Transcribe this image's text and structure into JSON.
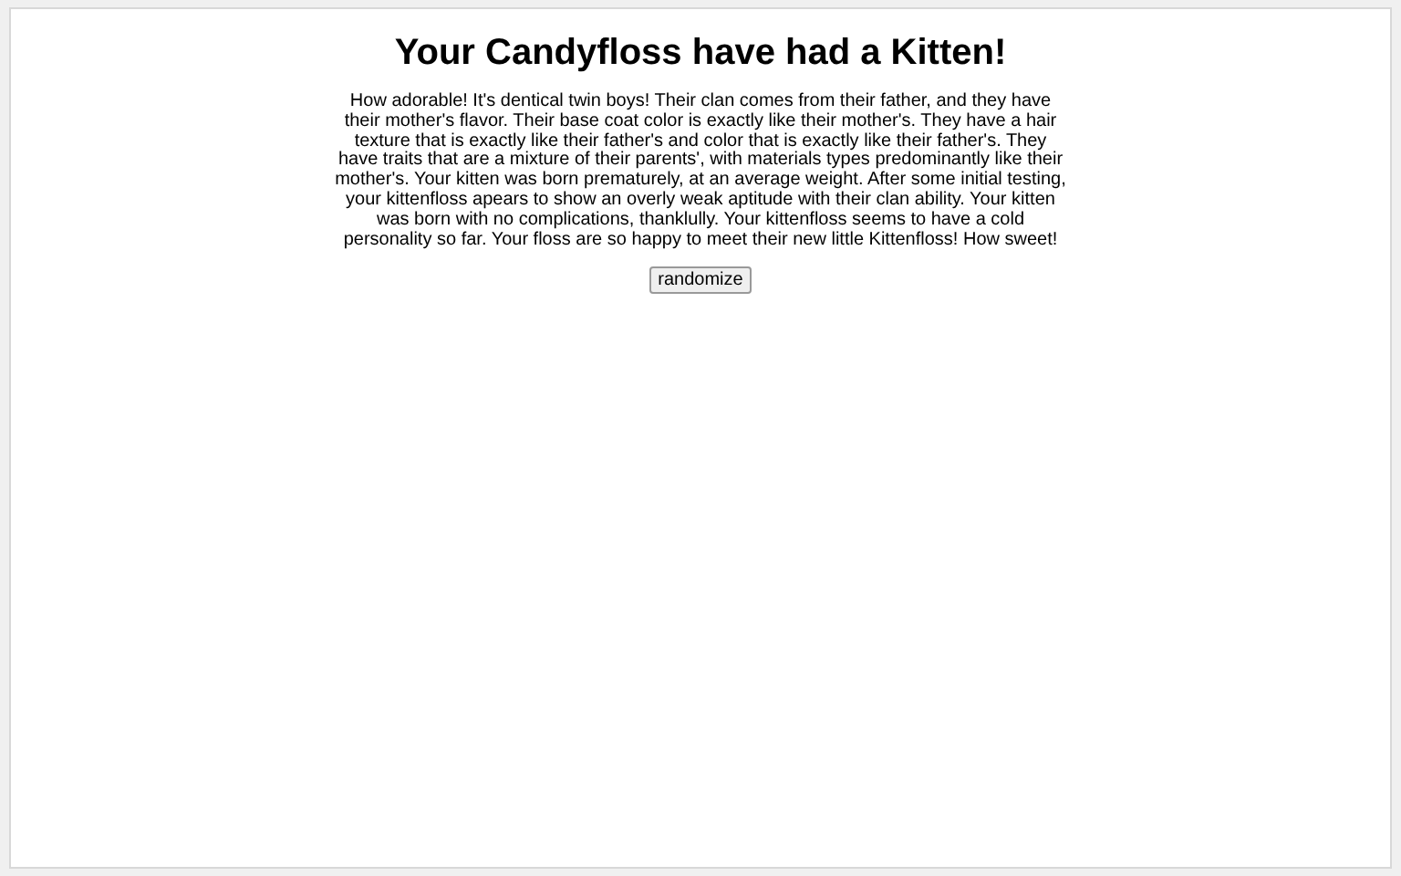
{
  "title": "Your Candyfloss have had a Kitten!",
  "description": "How adorable! It's dentical twin boys! Their clan comes from their father, and they have their mother's flavor. Their base coat color is exactly like their mother's. They have a hair texture that is exactly like their father's and color that is exactly like their father's. They have traits that are a mixture of their parents', with materials types predominantly like their mother's. Your kitten was born prematurely, at an average weight. After some initial testing, your kittenfloss apears to show an overly weak aptitude with their clan ability. Your kitten was born with no complications, thanklully. Your kittenfloss seems to have a cold personality so far. Your floss are so happy to meet their new little Kittenfloss! How sweet!",
  "button": "randomize"
}
